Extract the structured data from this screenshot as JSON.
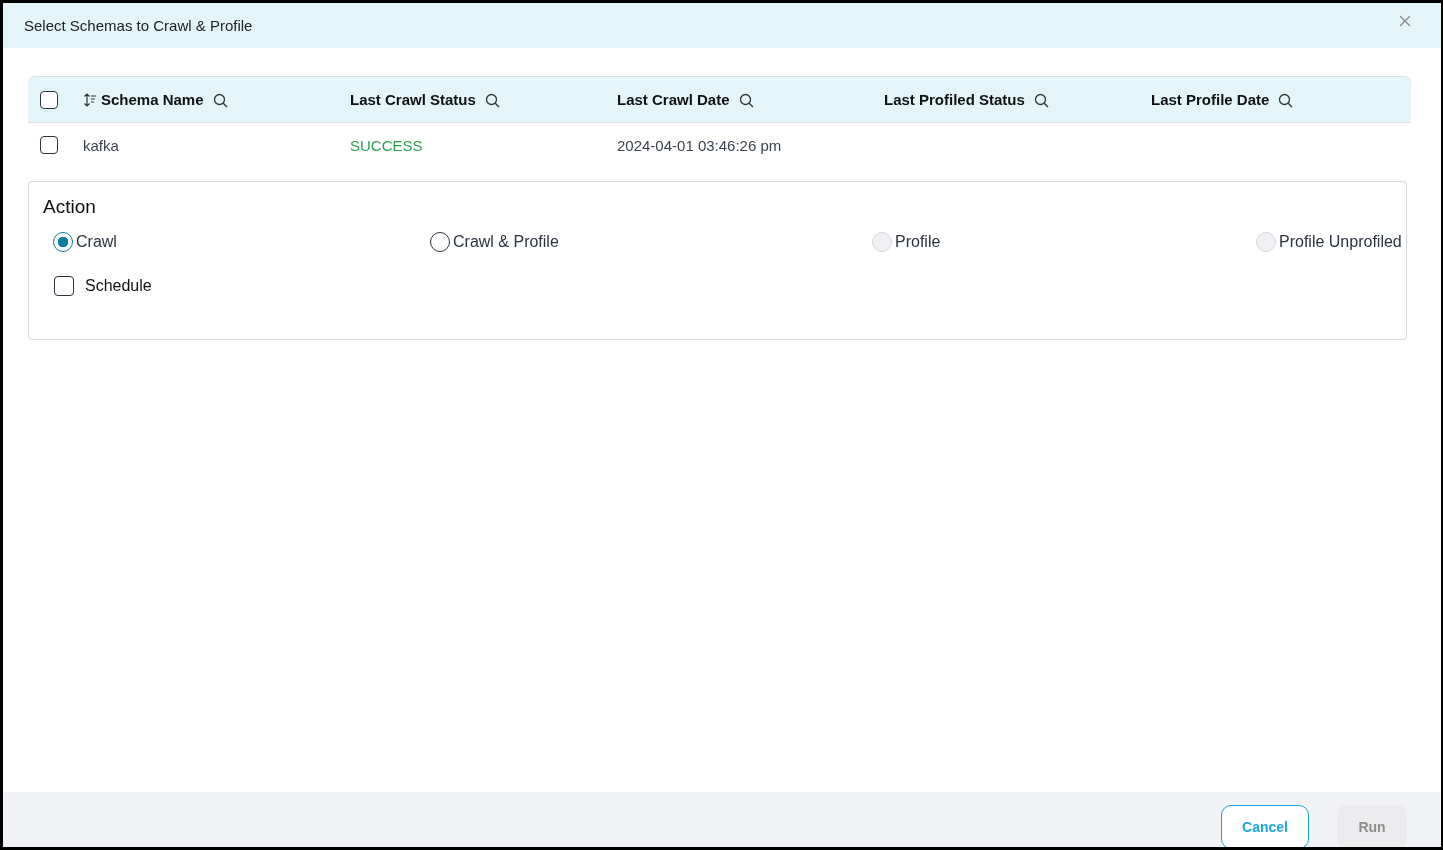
{
  "dialog": {
    "title": "Select Schemas to Crawl & Profile"
  },
  "table": {
    "select_all": {
      "checked": false
    },
    "columns": [
      {
        "label": "Schema Name",
        "sortable": true
      },
      {
        "label": "Last Crawl Status",
        "sortable": false
      },
      {
        "label": "Last Crawl Date",
        "sortable": false
      },
      {
        "label": "Last Profiled Status",
        "sortable": false
      },
      {
        "label": "Last Profile Date",
        "sortable": false
      }
    ],
    "rows": [
      {
        "checked": false,
        "cells": [
          {
            "text": "kafka",
            "kind": "text"
          },
          {
            "text": "SUCCESS",
            "kind": "success"
          },
          {
            "text": "2024-04-01 03:46:26 pm",
            "kind": "text"
          }
        ]
      }
    ]
  },
  "action": {
    "title": "Action",
    "options": [
      {
        "label": "Crawl",
        "selected": true,
        "disabled": false
      },
      {
        "label": "Crawl & Profile",
        "selected": false,
        "disabled": false
      },
      {
        "label": "Profile",
        "selected": false,
        "disabled": true
      },
      {
        "label": "Profile Unprofiled",
        "selected": false,
        "disabled": true
      }
    ],
    "schedule": {
      "label": "Schedule",
      "checked": false
    }
  },
  "buttons": [
    {
      "label": "Cancel",
      "disabled": false
    },
    {
      "label": "Run",
      "disabled": true
    }
  ]
}
